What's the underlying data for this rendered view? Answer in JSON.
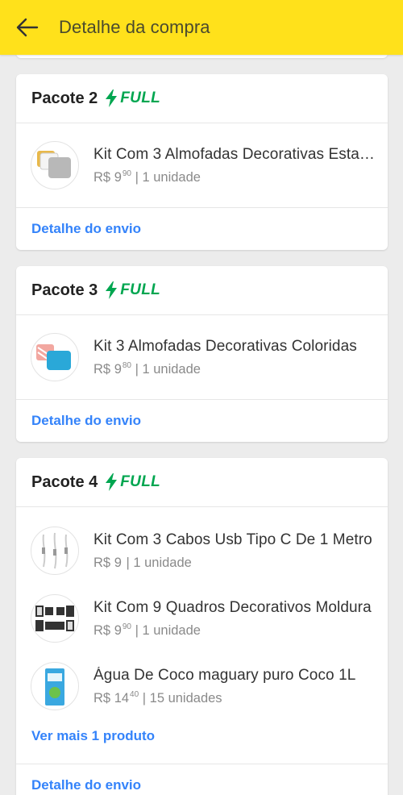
{
  "header": {
    "title": "Detalhe da compra",
    "back_icon": "arrow-left-icon",
    "background": "#ffe11b"
  },
  "colors": {
    "full": "#00a650",
    "link": "#3483fa"
  },
  "packages": [
    {
      "title": "Pacote 2",
      "badge": "FULL",
      "items": [
        {
          "name": "Kit Com 3 Almofadas Decorativas Estampadas",
          "currency": "R$",
          "price_int": "9",
          "price_cents": "90",
          "qty": "1 unidade"
        }
      ],
      "detail_link": "Detalhe do envio"
    },
    {
      "title": "Pacote 3",
      "badge": "FULL",
      "items": [
        {
          "name": "Kit 3 Almofadas Decorativas Coloridas",
          "currency": "R$",
          "price_int": "9",
          "price_cents": "80",
          "qty": "1 unidade"
        }
      ],
      "detail_link": "Detalhe do envio"
    },
    {
      "title": "Pacote 4",
      "badge": "FULL",
      "items": [
        {
          "name": "Kit Com 3 Cabos Usb Tipo C De 1 Metro",
          "currency": "R$",
          "price_int": "9",
          "price_cents": "",
          "qty": "1 unidade"
        },
        {
          "name": "Kit Com 9 Quadros Decorativos Moldura",
          "currency": "R$",
          "price_int": "9",
          "price_cents": "90",
          "qty": "1 unidade"
        },
        {
          "name": "Água De Coco maguary puro Coco 1L",
          "currency": "R$",
          "price_int": "14",
          "price_cents": "40",
          "qty": "15 unidades"
        }
      ],
      "more_link": "Ver mais 1 produto",
      "detail_link": "Detalhe do envio"
    }
  ]
}
